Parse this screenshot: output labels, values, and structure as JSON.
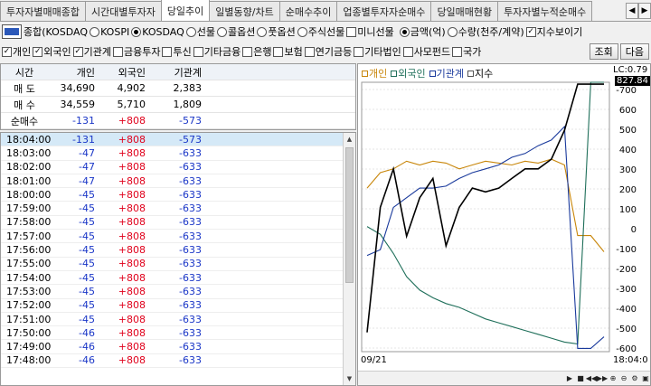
{
  "tabs": [
    "투자자별매매종합",
    "시간대별투자자",
    "당일추이",
    "일별동향/차트",
    "순매수추이",
    "업종별투자자순매수",
    "당일매매현황",
    "투자자별누적순매수"
  ],
  "active_tab": 2,
  "toolbar": {
    "market_select": "종합(KOSDAQ",
    "radio_kospi": "KOSPI",
    "radio_kosdaq": "KOSDAQ",
    "radio_futures": "선물",
    "radio_call": "콜옵션",
    "radio_put": "풋옵션",
    "radio_stock_fut": "주식선물",
    "mini_futures": "미니선물",
    "radio_amount": "금액(억)",
    "radio_qty": "수량(천주/계약)",
    "index_view": "지수보이기"
  },
  "filters": [
    "개인",
    "외국인",
    "기관계",
    "금융투자",
    "투신",
    "기타금융",
    "은행",
    "보험",
    "연기금등",
    "기타법인",
    "사모펀드",
    "국가"
  ],
  "filters_checked": [
    true,
    true,
    true,
    false,
    false,
    false,
    false,
    false,
    false,
    false,
    false,
    false
  ],
  "buttons": {
    "query": "조회",
    "next": "다음"
  },
  "summary": {
    "headers": [
      "시간",
      "개인",
      "외국인",
      "기관계"
    ],
    "rows": [
      {
        "label": "매 도",
        "v": [
          "34,690",
          "4,902",
          "2,383"
        ]
      },
      {
        "label": "매 수",
        "v": [
          "34,559",
          "5,710",
          "1,809"
        ]
      },
      {
        "label": "순매수",
        "v": [
          "-131",
          "+808",
          "-573"
        ]
      }
    ]
  },
  "list": [
    [
      "18:04:00",
      "-131",
      "+808",
      "-573"
    ],
    [
      "18:03:00",
      "-47",
      "+808",
      "-633"
    ],
    [
      "18:02:00",
      "-47",
      "+808",
      "-633"
    ],
    [
      "18:01:00",
      "-47",
      "+808",
      "-633"
    ],
    [
      "18:00:00",
      "-45",
      "+808",
      "-633"
    ],
    [
      "17:59:00",
      "-45",
      "+808",
      "-633"
    ],
    [
      "17:58:00",
      "-45",
      "+808",
      "-633"
    ],
    [
      "17:57:00",
      "-45",
      "+808",
      "-633"
    ],
    [
      "17:56:00",
      "-45",
      "+808",
      "-633"
    ],
    [
      "17:55:00",
      "-45",
      "+808",
      "-633"
    ],
    [
      "17:54:00",
      "-45",
      "+808",
      "-633"
    ],
    [
      "17:53:00",
      "-45",
      "+808",
      "-633"
    ],
    [
      "17:52:00",
      "-45",
      "+808",
      "-633"
    ],
    [
      "17:51:00",
      "-45",
      "+808",
      "-633"
    ],
    [
      "17:50:00",
      "-46",
      "+808",
      "-633"
    ],
    [
      "17:49:00",
      "-46",
      "+808",
      "-633"
    ],
    [
      "17:48:00",
      "-46",
      "+808",
      "-633"
    ]
  ],
  "chart": {
    "legend": [
      "개인",
      "외국인",
      "기관계",
      "지수"
    ],
    "legend_colors": [
      "#c8860a",
      "#1f6f5a",
      "#1a3a9c",
      "#000000"
    ],
    "top_label": "LC:0.79",
    "index_value": "827.84",
    "y_ticks": [
      "-700",
      "600",
      "500",
      "400",
      "300",
      "200",
      "100",
      "0",
      "-100",
      "-200",
      "-300",
      "-400",
      "-500",
      "-600"
    ],
    "x_start": "09/21",
    "x_end": "18:04:0"
  },
  "chart_data": {
    "type": "line",
    "ylim": [
      -650,
      750
    ],
    "y_ticks": [
      -700,
      600,
      500,
      400,
      300,
      200,
      100,
      0,
      -100,
      -200,
      -300,
      -400,
      -500,
      -600
    ],
    "series": [
      {
        "name": "개인",
        "values": [
          200,
          280,
          300,
          340,
          320,
          340,
          330,
          300,
          320,
          340,
          330,
          320,
          340,
          330,
          350,
          320,
          -47,
          -47,
          -131
        ]
      },
      {
        "name": "외국인",
        "values": [
          0,
          -40,
          -140,
          -260,
          -330,
          -370,
          -400,
          -420,
          -450,
          -480,
          -500,
          -520,
          -540,
          -560,
          -580,
          -600,
          -610,
          808,
          808
        ]
      },
      {
        "name": "기관계",
        "values": [
          -150,
          -120,
          100,
          150,
          200,
          200,
          210,
          250,
          280,
          300,
          320,
          360,
          380,
          420,
          450,
          520,
          -633,
          -633,
          -573
        ]
      },
      {
        "name": "지수",
        "values": [
          -550,
          100,
          300,
          -50,
          150,
          250,
          -100,
          100,
          200,
          180,
          200,
          250,
          300,
          300,
          350,
          500,
          740,
          740,
          740
        ]
      }
    ]
  }
}
